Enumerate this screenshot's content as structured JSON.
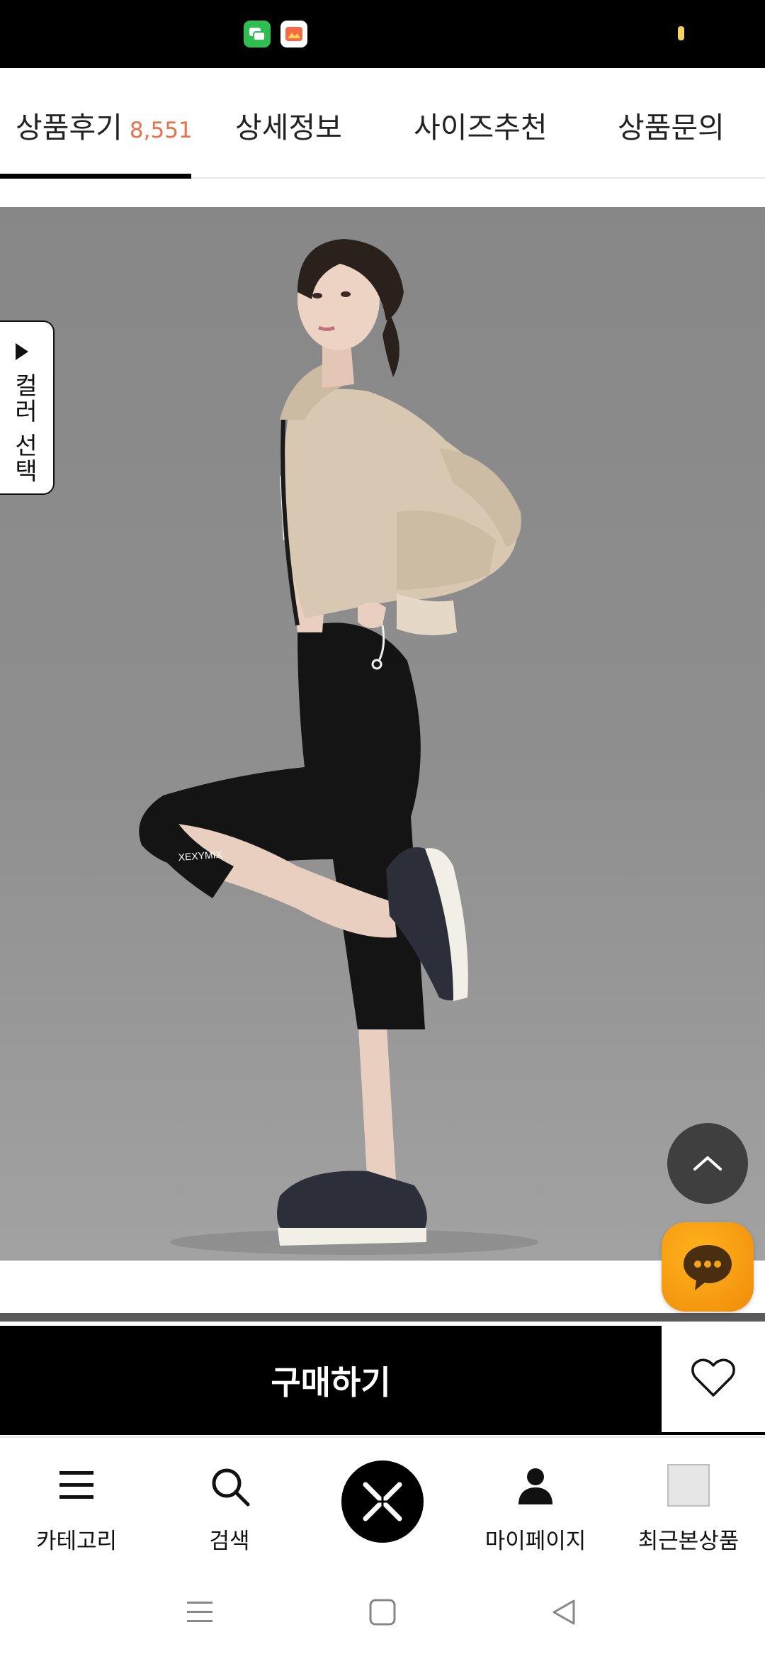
{
  "status_bar": {
    "icons": [
      "messages-app-icon",
      "photo-app-icon",
      "battery-indicator-icon"
    ]
  },
  "tabs": [
    {
      "label": "상품후기",
      "count": "8,551",
      "active": true
    },
    {
      "label": "상세정보",
      "active": false
    },
    {
      "label": "사이즈추천",
      "active": false
    },
    {
      "label": "상품문의",
      "active": false
    }
  ],
  "product_image": {
    "alt": "",
    "brand_print": "XEXYMIX"
  },
  "color_select": {
    "label": "컬러 선택",
    "icon": "play-triangle-icon"
  },
  "floating": {
    "scroll_top_icon": "chevron-up-icon",
    "chat_icon": "chat-bubble-icon"
  },
  "buy_bar": {
    "buy_label": "구매하기",
    "wish_icon": "heart-outline-icon"
  },
  "bottom_nav": {
    "items": [
      {
        "label": "카테고리",
        "icon": "menu-icon"
      },
      {
        "label": "검색",
        "icon": "search-icon"
      },
      {
        "label": "",
        "icon": "brand-logo-icon"
      },
      {
        "label": "마이페이지",
        "icon": "person-icon"
      },
      {
        "label": "최근본상품",
        "icon": "recent-product-thumbnail"
      }
    ]
  },
  "system_nav": {
    "icons": [
      "recent-apps-icon",
      "home-icon",
      "back-icon"
    ]
  },
  "colors": {
    "accent_count": "#e8704a",
    "chat_orange": "#f59a10",
    "buy_bar": "#000000"
  }
}
